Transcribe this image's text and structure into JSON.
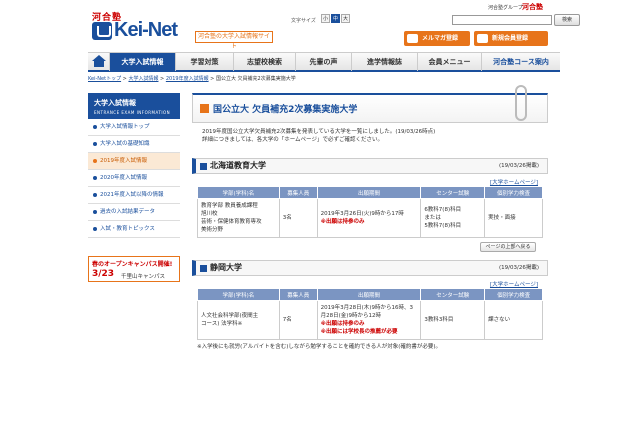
{
  "header": {
    "kawai_label": "河合塾",
    "logo_text": "Kei-Net",
    "tagline": "河合塾の大学入試情報サイト",
    "font_size_label": "文字サイズ",
    "font_sizes": [
      "小",
      "中",
      "大"
    ],
    "font_size_selected": "中",
    "group_label": "河合塾グループ",
    "group_logo": "河合塾",
    "search_placeholder": "",
    "search_button": "検索",
    "promo_mail": "メルマガ登録",
    "promo_register": "新規会員登録",
    "accent_color": "#1a4f9c",
    "orange_color": "#e7741a"
  },
  "nav": {
    "items": [
      "大学入試情報",
      "学習対策",
      "志望校検索",
      "先輩の声",
      "進学情報誌",
      "会員メニュー",
      "河合塾コース案内"
    ],
    "active": "大学入試情報"
  },
  "breadcrumb": {
    "items": [
      "Kei-Netトップ",
      "大学入試情報",
      "2019年度入試情報",
      "国公立大 欠員補充2次募集実施大学"
    ]
  },
  "sidebar": {
    "heading": "大学入試情報",
    "heading_en": "ENTRANCE EXAM INFORMATION",
    "items": [
      "大学入試情報トップ",
      "大学入試の基礎知識",
      "2019年度入試情報",
      "2020年度入試情報",
      "2021年度入試以降の情報",
      "過去の入試結果データ",
      "入試・教育トピックス"
    ],
    "active_index": 2,
    "banner_line1": "春のオープンキャンパス開催!",
    "banner_date": "3/23",
    "banner_place": "千里山キャンパス"
  },
  "main": {
    "title": "国公立大 欠員補充2次募集実施大学",
    "intro_line1": "2019年度国公立大学欠員補充2次募集を発表している大学を一覧にしました。(19/03/26時点)",
    "intro_line2": "詳細につきましては、各大学の「ホームページ」で必ずご確認ください。",
    "hp_link": "[大学ホームページ]",
    "top_button": "ページの上部へ戻る",
    "table_headers": [
      "学部(学科)名",
      "募集人員",
      "出願期間",
      "センター試験",
      "個別学力検査"
    ],
    "universities": [
      {
        "name": "北海道教育大学",
        "date": "(19/03/26掲載)",
        "rows": [
          {
            "dept": [
              "教育学部 教員養成課程",
              "旭川校",
              "芸術・保健体育教育専攻",
              "美術分野"
            ],
            "capacity": "3名",
            "period": [
              "2019年3月26日(火)9時から17時"
            ],
            "period_notes": [
              "※出願は持参のみ"
            ],
            "center": [
              "6教科7(8)科目",
              "または",
              "5教科7(8)科目"
            ],
            "individual": "実技・面接"
          }
        ]
      },
      {
        "name": "静岡大学",
        "date": "(19/03/26掲載)",
        "rows": [
          {
            "dept": [
              "人文社会科学部(夜間主",
              "コース) 法学科※"
            ],
            "capacity": "7名",
            "period": [
              "2019年3月28日(木)9時から16時、3",
              "月28日(金)9時から12時"
            ],
            "period_notes": [
              "※出願は持参のみ",
              "※出願には学校長の推薦が必要"
            ],
            "center": [
              "3教科3科目"
            ],
            "individual": "課さない"
          }
        ]
      }
    ],
    "footnote": "※入学後にも就労(アルバイトを含む)しながら勉学することを確約できる人が対象(確約書が必要)。"
  }
}
